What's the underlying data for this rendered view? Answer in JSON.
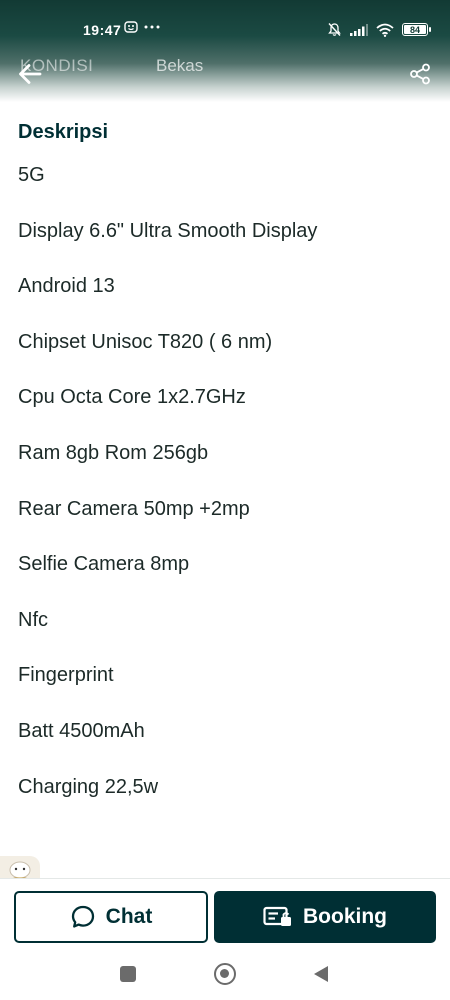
{
  "status_bar": {
    "time": "19:47",
    "left_icons": [
      "emoji-notification-icon",
      "more-dots-icon"
    ],
    "right_icons": [
      "mute-bell-icon",
      "signal-icon",
      "wifi-icon",
      "battery-icon"
    ],
    "battery": "84"
  },
  "app_bar": {
    "kondisi_label": "KONDISI",
    "kondisi_value": "Bekas"
  },
  "description": {
    "title": "Deskripsi",
    "items": [
      "5G",
      "Display 6.6\" Ultra Smooth Display",
      "Android 13",
      "Chipset Unisoc T820 ( 6 nm)",
      "Cpu Octa Core 1x2.7GHz",
      "Ram 8gb Rom 256gb",
      "Rear Camera 50mp +2mp",
      "Selfie Camera 8mp",
      "Nfc",
      "Fingerprint",
      "Batt 4500mAh",
      "Charging 22,5w"
    ]
  },
  "actions": {
    "chat_label": "Chat",
    "booking_label": "Booking"
  },
  "colors": {
    "brand_dark": "#002f34",
    "header_dark": "#123a34",
    "text": "#1c2a28"
  }
}
